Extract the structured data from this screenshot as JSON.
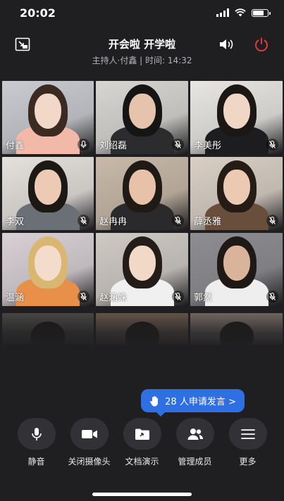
{
  "status": {
    "time": "20:02",
    "battery_level": 0.8
  },
  "header": {
    "title": "开会啦 开学啦",
    "subtitle": "主持人·付鑫 | 时间: 14:32",
    "icons": [
      "screen-share-icon",
      "speaker-icon",
      "power-icon"
    ]
  },
  "participants": [
    {
      "name": "付鑫",
      "bg": "#c9cbd0",
      "skin": "#f1d8c8",
      "hair": "#3b2a22",
      "shirt": "#f2b8a8",
      "host": true
    },
    {
      "name": "刘绍磊",
      "bg": "#d7d6d2",
      "skin": "#e6c3ac",
      "hair": "#151515",
      "shirt": "#2c2c2e"
    },
    {
      "name": "李美彤",
      "bg": "#e8e6e2",
      "skin": "#f0d6c4",
      "hair": "#1b1715",
      "shirt": "#1d1d1f"
    },
    {
      "name": "李双",
      "bg": "#e4e1dc",
      "skin": "#eccab4",
      "hair": "#1c1816",
      "shirt": "#6b6f76"
    },
    {
      "name": "赵冉冉",
      "bg": "#c8b9a8",
      "skin": "#e8c2a8",
      "hair": "#201a16",
      "shirt": "#2a2a2c"
    },
    {
      "name": "薛丞雅",
      "bg": "#d9cfc5",
      "skin": "#ecc9b2",
      "hair": "#261c16",
      "shirt": "#6a4e3c"
    },
    {
      "name": "温涵",
      "bg": "#d8d0d4",
      "skin": "#f4dccc",
      "hair": "#d9b772",
      "shirt": "#e8904a"
    },
    {
      "name": "赵涵姝",
      "bg": "#cfcac4",
      "skin": "#f2d8c6",
      "hair": "#231c18",
      "shirt": "#f0f0f0"
    },
    {
      "name": "郭然",
      "bg": "#8e8d92",
      "skin": "#d9b39a",
      "hair": "#1e1916",
      "shirt": "#eeeeee"
    }
  ],
  "partial_tiles": [
    {
      "bg": "#4d4a47"
    },
    {
      "bg": "#6a5a4e"
    },
    {
      "bg": "#7a6e68"
    }
  ],
  "request": {
    "label": "28 人申请发言 >",
    "icon": "raised-hand-icon"
  },
  "toolbar": [
    {
      "label": "静音",
      "icon": "microphone-icon",
      "name": "mute-button"
    },
    {
      "label": "关闭摄像头",
      "icon": "camera-icon",
      "name": "camera-button"
    },
    {
      "label": "文档演示",
      "icon": "folder-share-icon",
      "name": "document-share-button"
    },
    {
      "label": "管理成员",
      "icon": "members-icon",
      "name": "manage-members-button"
    },
    {
      "label": "更多",
      "icon": "menu-icon",
      "name": "more-button"
    }
  ]
}
